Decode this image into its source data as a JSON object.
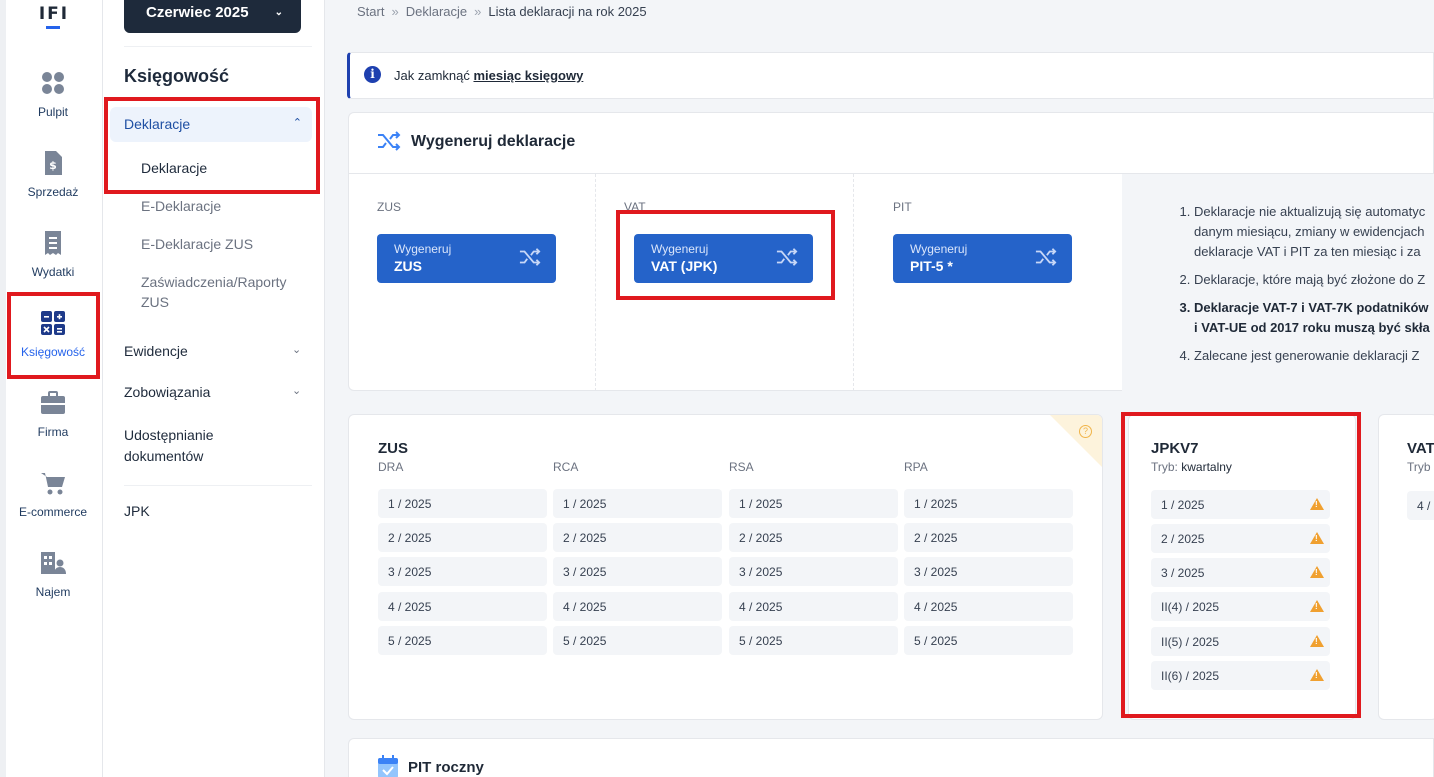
{
  "logo": "IFI",
  "rail": [
    {
      "label": "Pulpit",
      "icon": "dashboard-icon"
    },
    {
      "label": "Sprzedaż",
      "icon": "invoice-icon"
    },
    {
      "label": "Wydatki",
      "icon": "receipt-icon"
    },
    {
      "label": "Księgowość",
      "icon": "calculator-icon"
    },
    {
      "label": "Firma",
      "icon": "briefcase-icon"
    },
    {
      "label": "E-commerce",
      "icon": "cart-icon"
    },
    {
      "label": "Najem",
      "icon": "building-icon"
    }
  ],
  "menu": {
    "month": "Czerwiec 2025",
    "title": "Księgowość",
    "active_group": "Deklaracje",
    "sub_items": [
      "Deklaracje",
      "E-Deklaracje",
      "E-Deklaracje ZUS",
      "Zaświadczenia/Raporty ZUS"
    ],
    "groups": [
      "Ewidencje",
      "Zobowiązania",
      "Udostępnianie dokumentów",
      "JPK"
    ]
  },
  "breadcrumb": [
    "Start",
    "Deklaracje",
    "Lista deklaracji na rok 2025"
  ],
  "info": {
    "text": "Jak zamknąć ",
    "link": "miesiąc księgowy"
  },
  "generate": {
    "title": "Wygeneruj deklaracje",
    "columns": [
      {
        "label": "ZUS",
        "btn_small": "Wygeneruj",
        "btn_big": "ZUS"
      },
      {
        "label": "VAT",
        "btn_small": "Wygeneruj",
        "btn_big": "VAT (JPK)"
      },
      {
        "label": "PIT",
        "btn_small": "Wygeneruj",
        "btn_big": "PIT-5 *"
      }
    ],
    "notes": [
      "Deklaracje nie aktualizują się automatyc",
      "danym miesiącu, zmiany w ewidencjach",
      "deklaracje VAT i PIT za ten miesiąc i za",
      "Deklaracje, które mają być złożone do Z",
      "Deklaracje VAT-7 i VAT-7K podatników",
      "i VAT-UE od 2017 roku muszą być skła",
      "Zalecane jest generowanie deklaracji Z"
    ]
  },
  "zus": {
    "title": "ZUS",
    "columns": [
      "DRA",
      "RCA",
      "RSA",
      "RPA"
    ],
    "periods": [
      "1 / 2025",
      "2 / 2025",
      "3 / 2025",
      "4 / 2025",
      "5 / 2025"
    ]
  },
  "jpk": {
    "title": "JPKV7",
    "mode_label": "Tryb: ",
    "mode_value": "kwartalny",
    "periods": [
      "1 / 2025",
      "2 / 2025",
      "3 / 2025",
      "II(4) / 2025",
      "II(5) / 2025",
      "II(6) / 2025"
    ]
  },
  "vat": {
    "title": "VAT",
    "mode": "Tryb",
    "first": "4 /"
  },
  "pit": {
    "title": "PIT roczny"
  },
  "colors": {
    "primary": "#2563c9",
    "highlight": "#e0191e",
    "warning": "#f0a030",
    "dark": "#1e2a3b"
  }
}
